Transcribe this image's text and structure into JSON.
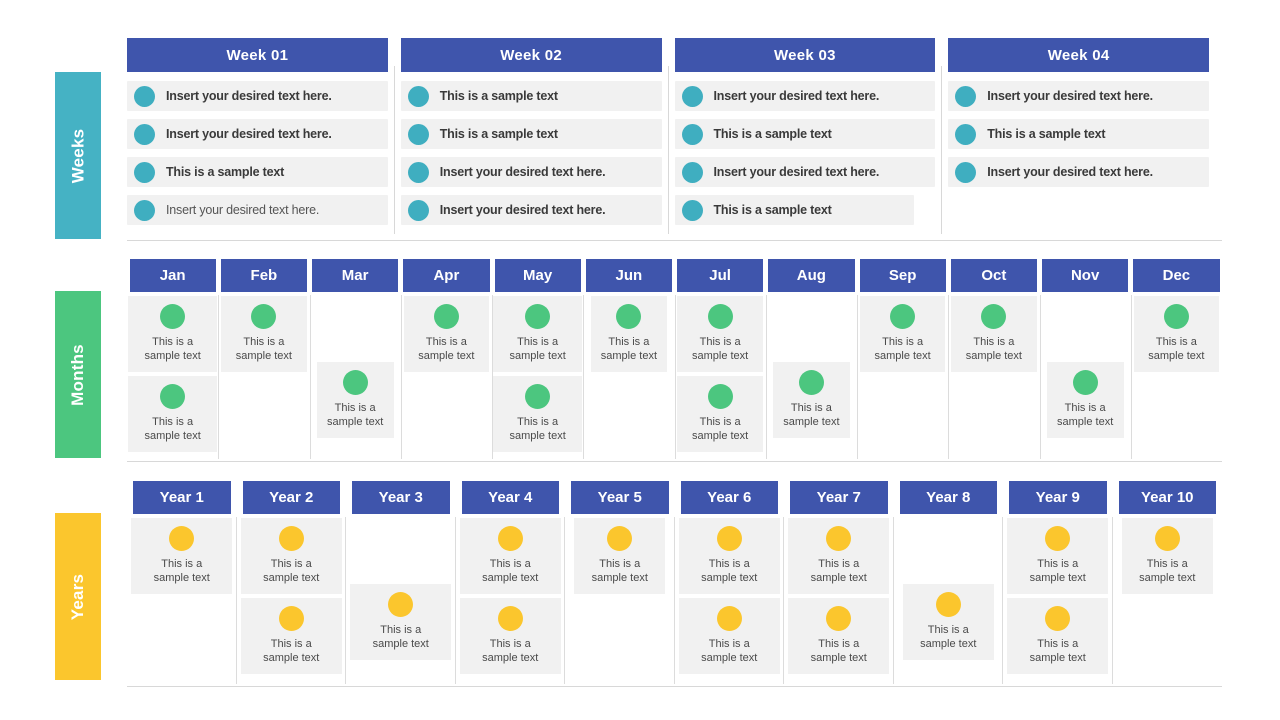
{
  "colors": {
    "header_blue": "#3F55AC",
    "weeks_tab_teal": "#45B2C4",
    "weeks_dot_teal": "#3FAEC0",
    "months_green": "#4CC67F",
    "years_yellow": "#FBC62D",
    "card_grey": "#F1F1F1",
    "text_dark": "#3A3A3A"
  },
  "sections": {
    "weeks": {
      "tab_label": "Weeks",
      "columns": [
        {
          "header": "Week 01",
          "items": [
            {
              "text": "Insert your desired text here.",
              "style": "bold",
              "width": "full"
            },
            {
              "text": "Insert your desired text here.",
              "style": "bold",
              "width": "full"
            },
            {
              "text": "This is a sample text",
              "style": "bold",
              "width": "full"
            },
            {
              "text": "Insert your desired text here.",
              "style": "light",
              "width": "full"
            }
          ]
        },
        {
          "header": "Week 02",
          "items": [
            {
              "text": "This is a sample text",
              "style": "bold",
              "width": "full"
            },
            {
              "text": "This is a sample text",
              "style": "bold",
              "width": "full"
            },
            {
              "text": "Insert your desired text here.",
              "style": "bold",
              "width": "full"
            },
            {
              "text": "Insert your desired text here.",
              "style": "bold",
              "width": "full"
            }
          ]
        },
        {
          "header": "Week 03",
          "items": [
            {
              "text": "Insert your desired text here.",
              "style": "bold",
              "width": "full"
            },
            {
              "text": "This is a sample text",
              "style": "bold",
              "width": "full"
            },
            {
              "text": "Insert your desired text here.",
              "style": "bold",
              "width": "full"
            },
            {
              "text": "This is a sample text",
              "style": "bold",
              "width": "short"
            }
          ]
        },
        {
          "header": "Week 04",
          "items": [
            {
              "text": "Insert your desired text here.",
              "style": "bold",
              "width": "full"
            },
            {
              "text": "This is a sample text",
              "style": "bold",
              "width": "full"
            },
            {
              "text": "Insert your desired text here.",
              "style": "bold",
              "width": "full"
            }
          ]
        }
      ]
    },
    "months": {
      "tab_label": "Months",
      "columns": [
        {
          "header": "Jan",
          "cells": [
            {
              "text": "This is a\nsample text",
              "width": "full"
            },
            {
              "text": "This is a\nsample text",
              "width": "full"
            }
          ]
        },
        {
          "header": "Feb",
          "cells": [
            {
              "text": "This is a\nsample text",
              "width": "wide"
            },
            null
          ]
        },
        {
          "header": "Mar",
          "cells": [
            null,
            {
              "text": "This is a\nsample text",
              "width": "mid"
            }
          ]
        },
        {
          "header": "Apr",
          "cells": [
            {
              "text": "This is a\nsample text",
              "width": "wide"
            },
            null
          ]
        },
        {
          "header": "May",
          "cells": [
            {
              "text": "This is a\nsample text",
              "width": "full"
            },
            {
              "text": "This is a\nsample text",
              "width": "full"
            }
          ]
        },
        {
          "header": "Jun",
          "cells": [
            {
              "text": "This is a\nsample text",
              "width": "mid"
            },
            null
          ]
        },
        {
          "header": "Jul",
          "cells": [
            {
              "text": "This is a\nsample text",
              "width": "wide"
            },
            {
              "text": "This is a\nsample text",
              "width": "wide"
            }
          ]
        },
        {
          "header": "Aug",
          "cells": [
            null,
            {
              "text": "This is a\nsample text",
              "width": "mid"
            }
          ]
        },
        {
          "header": "Sep",
          "cells": [
            {
              "text": "This is a\nsample text",
              "width": "wide"
            },
            null
          ]
        },
        {
          "header": "Oct",
          "cells": [
            {
              "text": "This is a\nsample text",
              "width": "wide"
            },
            null
          ]
        },
        {
          "header": "Nov",
          "cells": [
            null,
            {
              "text": "This is a\nsample text",
              "width": "mid"
            }
          ]
        },
        {
          "header": "Dec",
          "cells": [
            {
              "text": "This is a\nsample text",
              "width": "wide"
            },
            null
          ]
        }
      ]
    },
    "years": {
      "tab_label": "Years",
      "columns": [
        {
          "header": "Year 1",
          "cells": [
            {
              "text": "This is a\nsample text",
              "width": "wide"
            },
            null
          ]
        },
        {
          "header": "Year 2",
          "cells": [
            {
              "text": "This is a\nsample text",
              "width": "wide"
            },
            {
              "text": "This is a\nsample text",
              "width": "wide"
            }
          ]
        },
        {
          "header": "Year 3",
          "cells": [
            null,
            {
              "text": "This is a\nsample text",
              "width": "wide"
            }
          ]
        },
        {
          "header": "Year 4",
          "cells": [
            {
              "text": "This is a\nsample text",
              "width": "wide"
            },
            {
              "text": "This is a\nsample text",
              "width": "wide"
            }
          ]
        },
        {
          "header": "Year 5",
          "cells": [
            {
              "text": "This is a\nsample text",
              "width": "mid"
            },
            null
          ]
        },
        {
          "header": "Year 6",
          "cells": [
            {
              "text": "This is a\nsample text",
              "width": "wide"
            },
            {
              "text": "This is a\nsample text",
              "width": "wide"
            }
          ]
        },
        {
          "header": "Year 7",
          "cells": [
            {
              "text": "This is a\nsample text",
              "width": "wide"
            },
            {
              "text": "This is a\nsample text",
              "width": "wide"
            }
          ]
        },
        {
          "header": "Year 8",
          "cells": [
            null,
            {
              "text": "This is a\nsample text",
              "width": "mid"
            }
          ]
        },
        {
          "header": "Year 9",
          "cells": [
            {
              "text": "This is a\nsample text",
              "width": "wide"
            },
            {
              "text": "This is a\nsample text",
              "width": "wide"
            }
          ]
        },
        {
          "header": "Year 10",
          "cells": [
            {
              "text": "This is a\nsample text",
              "width": "mid"
            },
            null
          ]
        }
      ]
    }
  }
}
